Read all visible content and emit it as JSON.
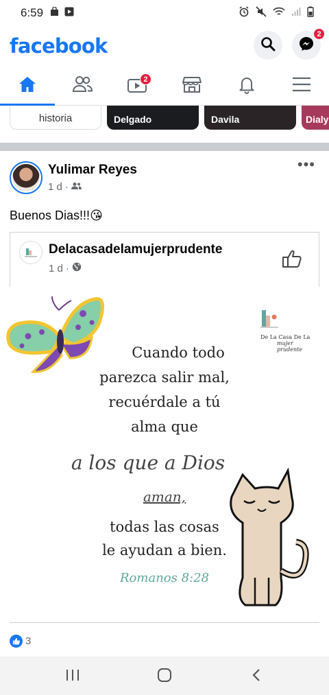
{
  "status_bar": {
    "time": "6:59"
  },
  "header": {
    "logo": "facebook",
    "messenger_badge": "2"
  },
  "nav": {
    "tabs": [
      {
        "name": "home",
        "icon": "home-icon",
        "active": true
      },
      {
        "name": "friends",
        "icon": "friends-icon"
      },
      {
        "name": "watch",
        "icon": "video-icon",
        "badge": "2"
      },
      {
        "name": "marketplace",
        "icon": "marketplace-icon"
      },
      {
        "name": "notifications",
        "icon": "bell-icon"
      },
      {
        "name": "menu",
        "icon": "menu-icon"
      }
    ]
  },
  "stories": [
    {
      "label": "historia"
    },
    {
      "label": "Delgado"
    },
    {
      "label": "Davila"
    },
    {
      "label": "Dialy"
    }
  ],
  "post": {
    "author": "Yulimar Reyes",
    "time": "1 d",
    "audience_icon": "friends-icon",
    "text": "Buenos Dias!!!",
    "emoji": "😘",
    "shared": {
      "page_name": "Delacasadelamujerprudente",
      "time": "1 d",
      "audience_icon": "globe-icon"
    },
    "image": {
      "brand_line1": "De La Casa De La",
      "brand_line2": "mujer prudente",
      "quote_lines": [
        "Cuando todo",
        "parezca salir mal,",
        "recuérdale a tú",
        "alma que"
      ],
      "script_line": "a los que a Dios",
      "script_line2": "aman,",
      "quote_lines2": [
        "todas las cosas",
        "le ayudan a bien."
      ],
      "reference": "Romanos 8:28"
    },
    "reactions_count": "3"
  },
  "colors": {
    "brand": "#1877f2",
    "badge": "#e41e3f"
  }
}
